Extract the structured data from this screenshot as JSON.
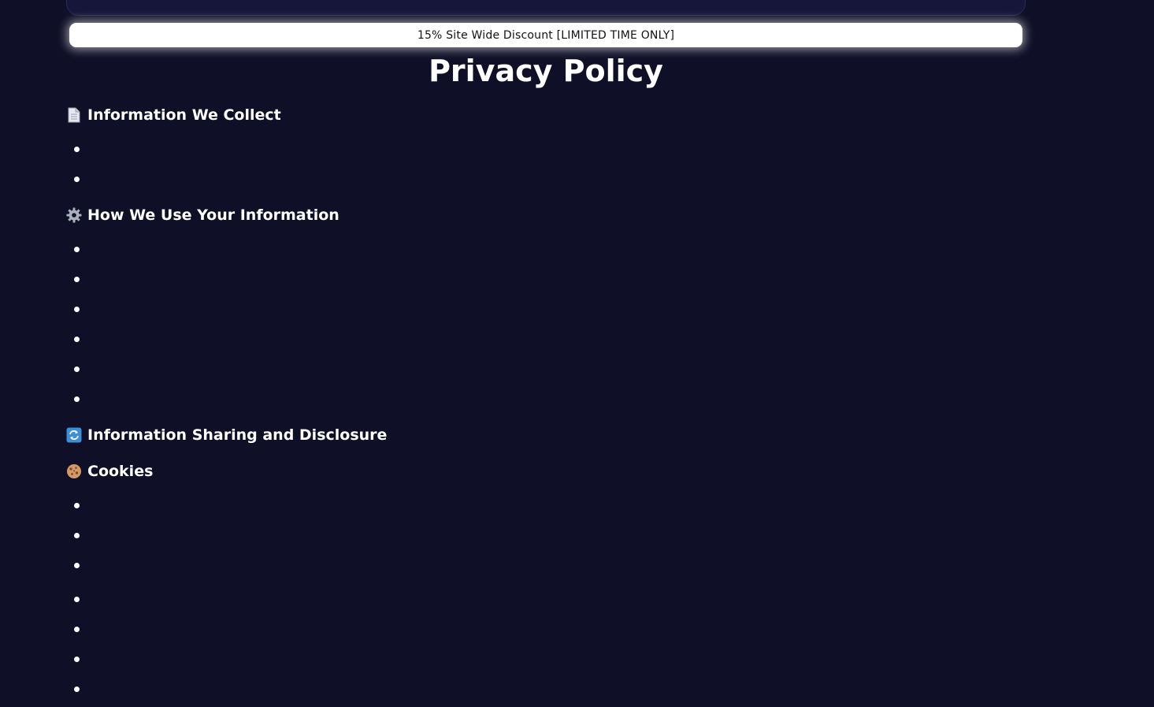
{
  "promo": {
    "text": "15% Site Wide Discount [LIMITED TIME ONLY]"
  },
  "page": {
    "title": "Privacy Policy"
  },
  "sections": [
    {
      "icon": "document-icon",
      "heading": "Information We Collect",
      "bullet_count": 2
    },
    {
      "icon": "gear-icon",
      "heading": "How We Use Your Information",
      "bullet_count": 6
    },
    {
      "icon": "refresh-icon",
      "heading": "Information Sharing and Disclosure",
      "bullet_count": 0
    },
    {
      "icon": "cookie-icon",
      "heading": "Cookies",
      "bullet_count": 7
    }
  ],
  "colors": {
    "background": "#0f0f27",
    "banner": "#ffffff",
    "text": "#ffffff"
  }
}
